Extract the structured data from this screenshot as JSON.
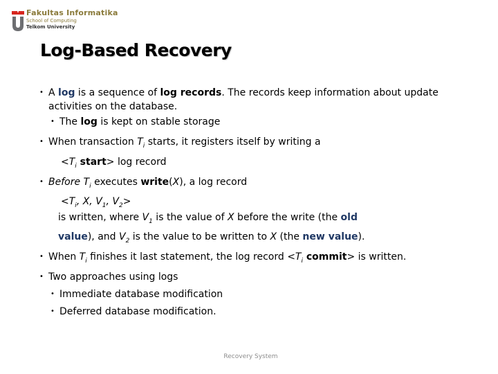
{
  "logo": {
    "line1": "Fakultas Informatika",
    "line2": "School of Computing",
    "line3": "Telkom University",
    "colors": {
      "red": "#d7261e",
      "gray": "#6d6e71",
      "gold": "#8a7a3a"
    }
  },
  "slide": {
    "title": "Log-Based Recovery",
    "b1": {
      "p1": "A ",
      "log": "log",
      "p2": " is a sequence of ",
      "log_records": "log records",
      "p3": ". The records keep information about update activities on the database.",
      "sub": {
        "p1": "The ",
        "log": "log",
        "p2": " is kept on stable storage"
      }
    },
    "b2": {
      "p1": "When transaction ",
      "T": "T",
      "i": "i",
      "p2": " starts, it registers itself by writing a",
      "rec_open": "<",
      "rec_T": "T",
      "rec_i": "i",
      "rec_start": " start",
      "rec_close": ">",
      "rec_tail": " log record"
    },
    "b3": {
      "before": "Before",
      "T": " T",
      "i": "i",
      "p1": " executes ",
      "write": "write",
      "paren_open": "(",
      "X": "X",
      "paren_close": ")",
      "p2": ", a log record",
      "tuple_open": "<",
      "tuple_T": "T",
      "tuple_i": "i",
      "tuple_mid1": ", X,  V",
      "tuple_1": "1",
      "tuple_mid2": ",  V",
      "tuple_2": "2",
      "tuple_close": ">",
      "w1": "is written, where ",
      "V": "V",
      "one": "1",
      "w2": " is the value of ",
      "X2": "X",
      "w3": "  before the write (the ",
      "old": "old",
      "w4_value": "value",
      "w5": "), and ",
      "V2": "V",
      "two": "2",
      "w6": " is the value to be written to ",
      "X3": "X",
      "w7": " (the ",
      "new_value": "new value",
      "w8": ")."
    },
    "b4": {
      "p1": "When ",
      "T": "T",
      "i": "i",
      "p2": " finishes it last statement, the log record <",
      "T2": "T",
      "i2": "i",
      "commit": "  commit",
      "p3": "> is written."
    },
    "b5": {
      "text": "Two approaches using logs",
      "items": [
        "Immediate database modification",
        "Deferred database modification."
      ]
    }
  },
  "footer": {
    "text": "Recovery System"
  }
}
